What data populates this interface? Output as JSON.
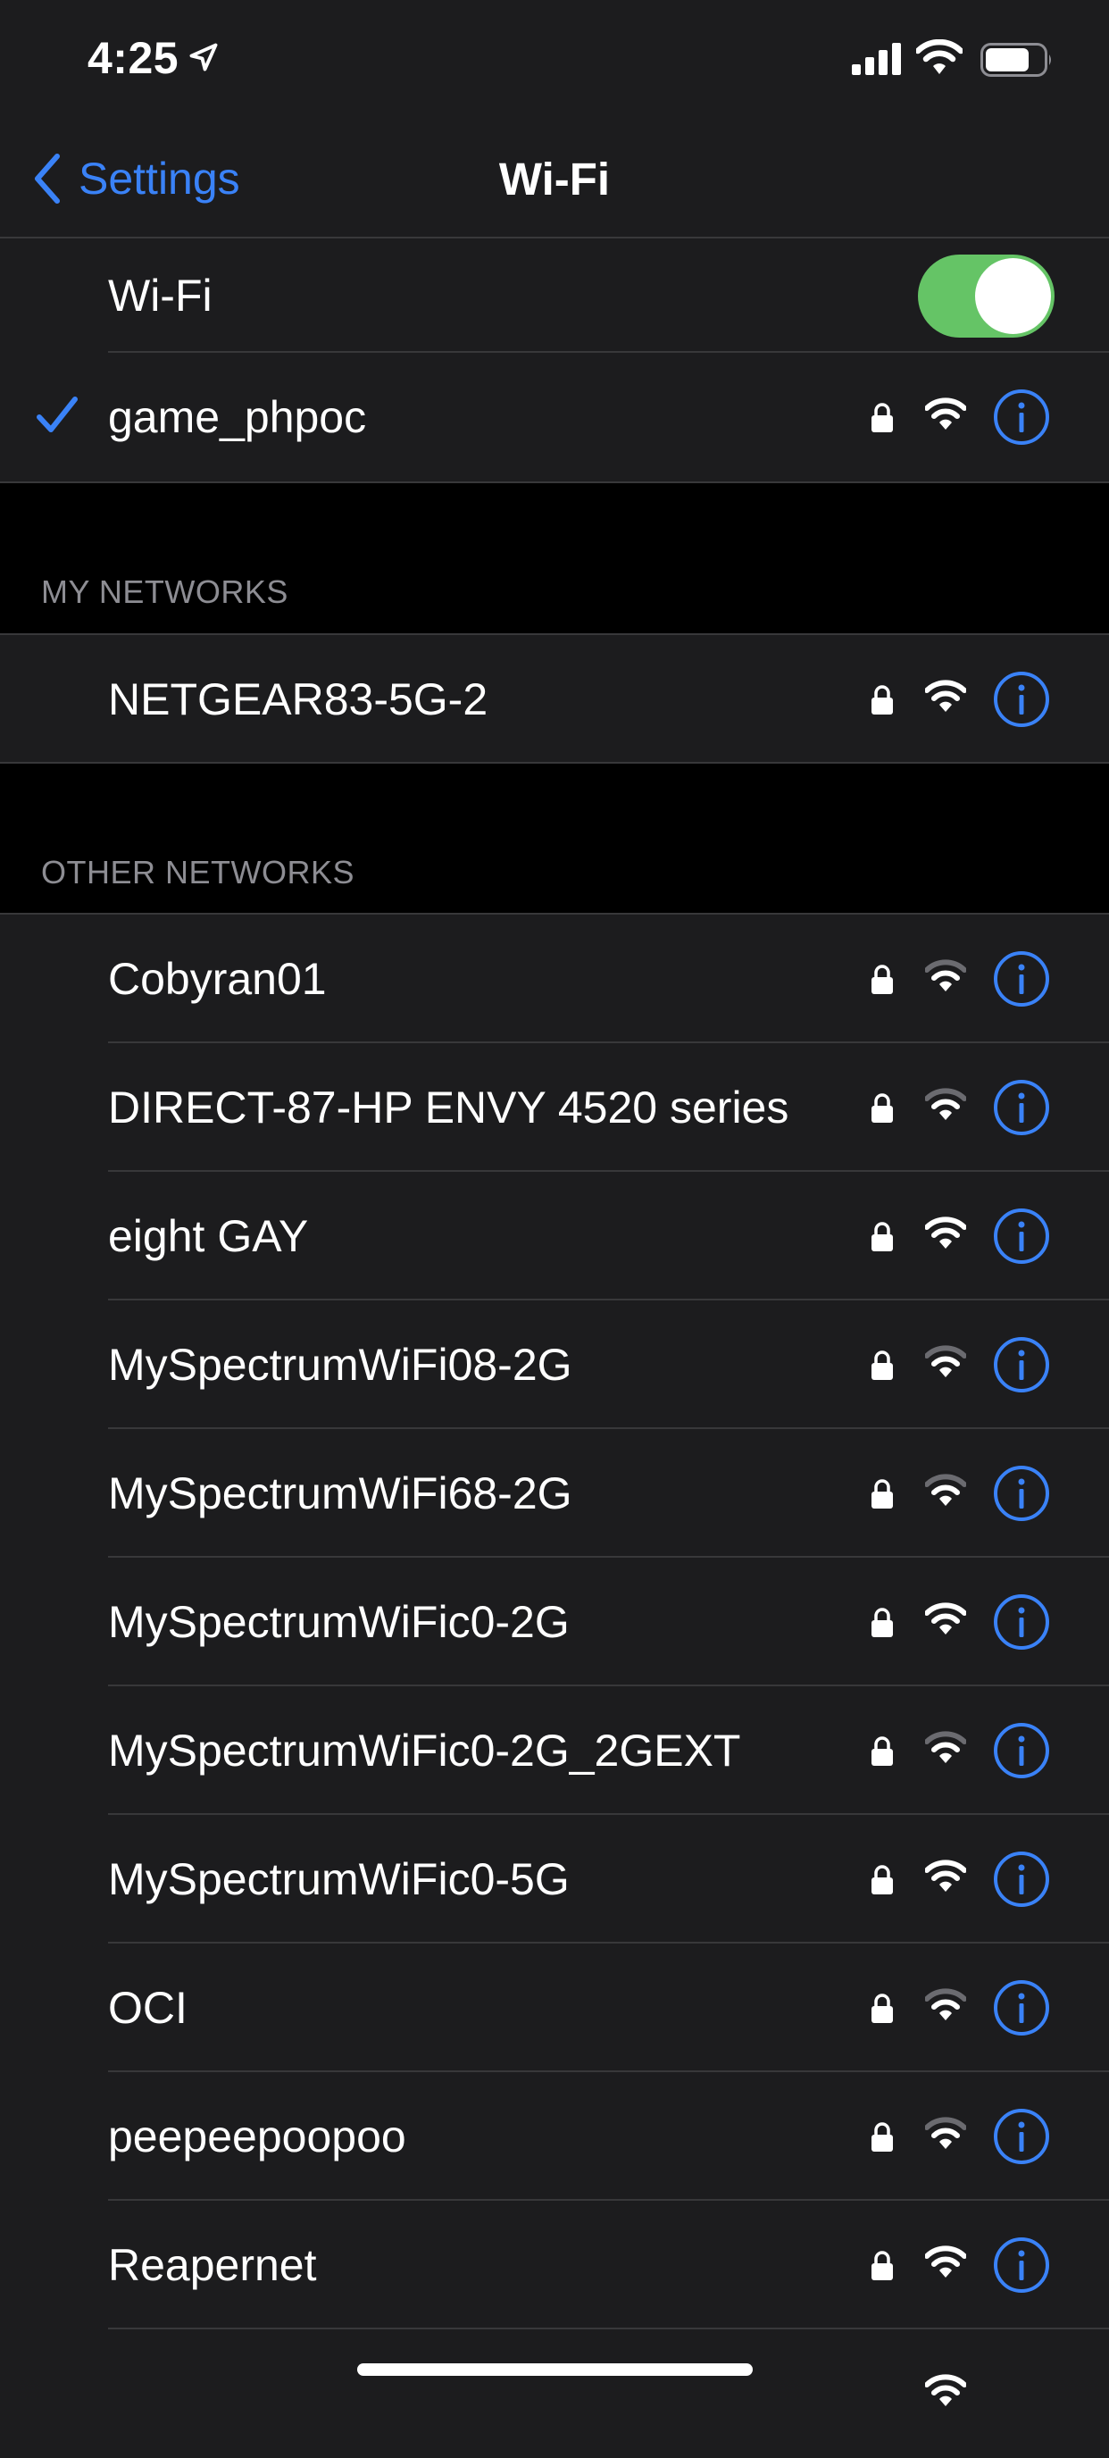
{
  "status_bar": {
    "time": "4:25",
    "icons": [
      "location-arrow-icon",
      "cellular-signal-icon",
      "wifi-icon",
      "battery-icon"
    ]
  },
  "nav": {
    "back_label": "Settings",
    "title": "Wi-Fi"
  },
  "wifi_toggle": {
    "label": "Wi-Fi",
    "on": true
  },
  "connected_network": {
    "name": "game_phpoc",
    "secured": true,
    "signal_bars": 3,
    "selected": true
  },
  "my_networks": {
    "header": "MY NETWORKS",
    "items": [
      {
        "name": "NETGEAR83-5G-2",
        "secured": true,
        "signal_bars": 3
      }
    ]
  },
  "other_networks": {
    "header": "OTHER NETWORKS",
    "items": [
      {
        "name": "Cobyran01",
        "secured": true,
        "signal_bars": 2
      },
      {
        "name": "DIRECT-87-HP ENVY 4520 series",
        "secured": true,
        "signal_bars": 2
      },
      {
        "name": "eight GAY",
        "secured": true,
        "signal_bars": 3
      },
      {
        "name": "MySpectrumWiFi08-2G",
        "secured": true,
        "signal_bars": 2
      },
      {
        "name": "MySpectrumWiFi68-2G",
        "secured": true,
        "signal_bars": 2
      },
      {
        "name": "MySpectrumWiFic0-2G",
        "secured": true,
        "signal_bars": 3
      },
      {
        "name": "MySpectrumWiFic0-2G_2GEXT",
        "secured": true,
        "signal_bars": 2
      },
      {
        "name": "MySpectrumWiFic0-5G",
        "secured": true,
        "signal_bars": 3
      },
      {
        "name": "OCI",
        "secured": true,
        "signal_bars": 2
      },
      {
        "name": "peepeepoopoo",
        "secured": true,
        "signal_bars": 2
      },
      {
        "name": "Reapernet",
        "secured": true,
        "signal_bars": 3
      },
      {
        "name": "",
        "secured": false,
        "signal_bars": 3
      }
    ]
  },
  "colors": {
    "accent": "#3a82f7",
    "toggle_on": "#65c466",
    "row_bg": "#1c1c1e",
    "separator": "#38383a",
    "wifi_strong": "#ffffff",
    "wifi_dim": "#6b6b70"
  }
}
